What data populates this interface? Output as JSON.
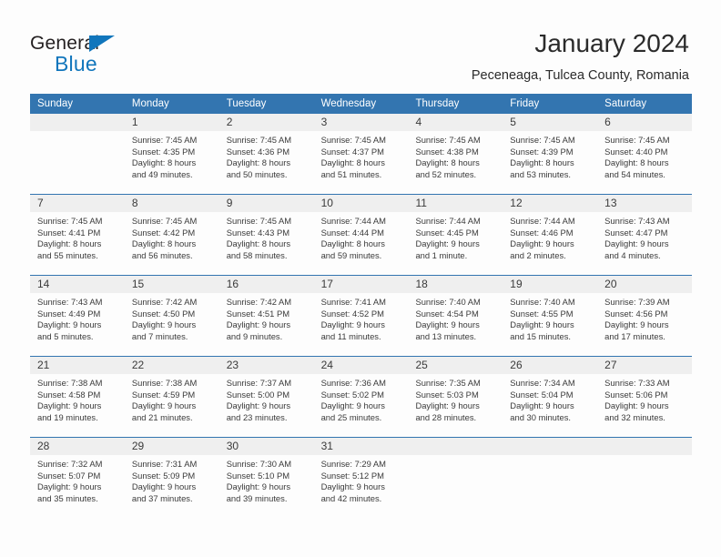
{
  "brand": {
    "name_part1": "General",
    "name_part2": "Blue",
    "triangle_color": "#1176bc"
  },
  "header": {
    "title": "January 2024",
    "subtitle": "Peceneaga, Tulcea County, Romania"
  },
  "theme": {
    "header_blue": "#3375b0",
    "daynum_band": "#efefef",
    "text": "#3a3a3a",
    "page_background": "#fdfdfd"
  },
  "calendar": {
    "day_headers": [
      "Sunday",
      "Monday",
      "Tuesday",
      "Wednesday",
      "Thursday",
      "Friday",
      "Saturday"
    ],
    "weeks": [
      [
        {
          "day": "",
          "sunrise": "",
          "sunset": "",
          "daylight_line1": "",
          "daylight_line2": ""
        },
        {
          "day": "1",
          "sunrise": "Sunrise: 7:45 AM",
          "sunset": "Sunset: 4:35 PM",
          "daylight_line1": "Daylight: 8 hours",
          "daylight_line2": "and 49 minutes."
        },
        {
          "day": "2",
          "sunrise": "Sunrise: 7:45 AM",
          "sunset": "Sunset: 4:36 PM",
          "daylight_line1": "Daylight: 8 hours",
          "daylight_line2": "and 50 minutes."
        },
        {
          "day": "3",
          "sunrise": "Sunrise: 7:45 AM",
          "sunset": "Sunset: 4:37 PM",
          "daylight_line1": "Daylight: 8 hours",
          "daylight_line2": "and 51 minutes."
        },
        {
          "day": "4",
          "sunrise": "Sunrise: 7:45 AM",
          "sunset": "Sunset: 4:38 PM",
          "daylight_line1": "Daylight: 8 hours",
          "daylight_line2": "and 52 minutes."
        },
        {
          "day": "5",
          "sunrise": "Sunrise: 7:45 AM",
          "sunset": "Sunset: 4:39 PM",
          "daylight_line1": "Daylight: 8 hours",
          "daylight_line2": "and 53 minutes."
        },
        {
          "day": "6",
          "sunrise": "Sunrise: 7:45 AM",
          "sunset": "Sunset: 4:40 PM",
          "daylight_line1": "Daylight: 8 hours",
          "daylight_line2": "and 54 minutes."
        }
      ],
      [
        {
          "day": "7",
          "sunrise": "Sunrise: 7:45 AM",
          "sunset": "Sunset: 4:41 PM",
          "daylight_line1": "Daylight: 8 hours",
          "daylight_line2": "and 55 minutes."
        },
        {
          "day": "8",
          "sunrise": "Sunrise: 7:45 AM",
          "sunset": "Sunset: 4:42 PM",
          "daylight_line1": "Daylight: 8 hours",
          "daylight_line2": "and 56 minutes."
        },
        {
          "day": "9",
          "sunrise": "Sunrise: 7:45 AM",
          "sunset": "Sunset: 4:43 PM",
          "daylight_line1": "Daylight: 8 hours",
          "daylight_line2": "and 58 minutes."
        },
        {
          "day": "10",
          "sunrise": "Sunrise: 7:44 AM",
          "sunset": "Sunset: 4:44 PM",
          "daylight_line1": "Daylight: 8 hours",
          "daylight_line2": "and 59 minutes."
        },
        {
          "day": "11",
          "sunrise": "Sunrise: 7:44 AM",
          "sunset": "Sunset: 4:45 PM",
          "daylight_line1": "Daylight: 9 hours",
          "daylight_line2": "and 1 minute."
        },
        {
          "day": "12",
          "sunrise": "Sunrise: 7:44 AM",
          "sunset": "Sunset: 4:46 PM",
          "daylight_line1": "Daylight: 9 hours",
          "daylight_line2": "and 2 minutes."
        },
        {
          "day": "13",
          "sunrise": "Sunrise: 7:43 AM",
          "sunset": "Sunset: 4:47 PM",
          "daylight_line1": "Daylight: 9 hours",
          "daylight_line2": "and 4 minutes."
        }
      ],
      [
        {
          "day": "14",
          "sunrise": "Sunrise: 7:43 AM",
          "sunset": "Sunset: 4:49 PM",
          "daylight_line1": "Daylight: 9 hours",
          "daylight_line2": "and 5 minutes."
        },
        {
          "day": "15",
          "sunrise": "Sunrise: 7:42 AM",
          "sunset": "Sunset: 4:50 PM",
          "daylight_line1": "Daylight: 9 hours",
          "daylight_line2": "and 7 minutes."
        },
        {
          "day": "16",
          "sunrise": "Sunrise: 7:42 AM",
          "sunset": "Sunset: 4:51 PM",
          "daylight_line1": "Daylight: 9 hours",
          "daylight_line2": "and 9 minutes."
        },
        {
          "day": "17",
          "sunrise": "Sunrise: 7:41 AM",
          "sunset": "Sunset: 4:52 PM",
          "daylight_line1": "Daylight: 9 hours",
          "daylight_line2": "and 11 minutes."
        },
        {
          "day": "18",
          "sunrise": "Sunrise: 7:40 AM",
          "sunset": "Sunset: 4:54 PM",
          "daylight_line1": "Daylight: 9 hours",
          "daylight_line2": "and 13 minutes."
        },
        {
          "day": "19",
          "sunrise": "Sunrise: 7:40 AM",
          "sunset": "Sunset: 4:55 PM",
          "daylight_line1": "Daylight: 9 hours",
          "daylight_line2": "and 15 minutes."
        },
        {
          "day": "20",
          "sunrise": "Sunrise: 7:39 AM",
          "sunset": "Sunset: 4:56 PM",
          "daylight_line1": "Daylight: 9 hours",
          "daylight_line2": "and 17 minutes."
        }
      ],
      [
        {
          "day": "21",
          "sunrise": "Sunrise: 7:38 AM",
          "sunset": "Sunset: 4:58 PM",
          "daylight_line1": "Daylight: 9 hours",
          "daylight_line2": "and 19 minutes."
        },
        {
          "day": "22",
          "sunrise": "Sunrise: 7:38 AM",
          "sunset": "Sunset: 4:59 PM",
          "daylight_line1": "Daylight: 9 hours",
          "daylight_line2": "and 21 minutes."
        },
        {
          "day": "23",
          "sunrise": "Sunrise: 7:37 AM",
          "sunset": "Sunset: 5:00 PM",
          "daylight_line1": "Daylight: 9 hours",
          "daylight_line2": "and 23 minutes."
        },
        {
          "day": "24",
          "sunrise": "Sunrise: 7:36 AM",
          "sunset": "Sunset: 5:02 PM",
          "daylight_line1": "Daylight: 9 hours",
          "daylight_line2": "and 25 minutes."
        },
        {
          "day": "25",
          "sunrise": "Sunrise: 7:35 AM",
          "sunset": "Sunset: 5:03 PM",
          "daylight_line1": "Daylight: 9 hours",
          "daylight_line2": "and 28 minutes."
        },
        {
          "day": "26",
          "sunrise": "Sunrise: 7:34 AM",
          "sunset": "Sunset: 5:04 PM",
          "daylight_line1": "Daylight: 9 hours",
          "daylight_line2": "and 30 minutes."
        },
        {
          "day": "27",
          "sunrise": "Sunrise: 7:33 AM",
          "sunset": "Sunset: 5:06 PM",
          "daylight_line1": "Daylight: 9 hours",
          "daylight_line2": "and 32 minutes."
        }
      ],
      [
        {
          "day": "28",
          "sunrise": "Sunrise: 7:32 AM",
          "sunset": "Sunset: 5:07 PM",
          "daylight_line1": "Daylight: 9 hours",
          "daylight_line2": "and 35 minutes."
        },
        {
          "day": "29",
          "sunrise": "Sunrise: 7:31 AM",
          "sunset": "Sunset: 5:09 PM",
          "daylight_line1": "Daylight: 9 hours",
          "daylight_line2": "and 37 minutes."
        },
        {
          "day": "30",
          "sunrise": "Sunrise: 7:30 AM",
          "sunset": "Sunset: 5:10 PM",
          "daylight_line1": "Daylight: 9 hours",
          "daylight_line2": "and 39 minutes."
        },
        {
          "day": "31",
          "sunrise": "Sunrise: 7:29 AM",
          "sunset": "Sunset: 5:12 PM",
          "daylight_line1": "Daylight: 9 hours",
          "daylight_line2": "and 42 minutes."
        },
        {
          "day": "",
          "sunrise": "",
          "sunset": "",
          "daylight_line1": "",
          "daylight_line2": ""
        },
        {
          "day": "",
          "sunrise": "",
          "sunset": "",
          "daylight_line1": "",
          "daylight_line2": ""
        },
        {
          "day": "",
          "sunrise": "",
          "sunset": "",
          "daylight_line1": "",
          "daylight_line2": ""
        }
      ]
    ]
  }
}
